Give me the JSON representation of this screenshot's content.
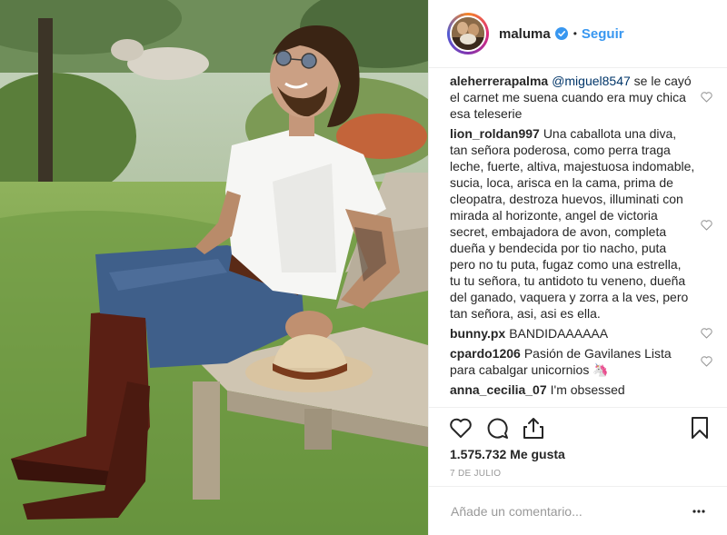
{
  "post": {
    "photo_alt": "post photo",
    "header": {
      "username": "maluma",
      "verified_icon": "verified-badge-icon",
      "separator": "•",
      "follow_label": "Seguir"
    },
    "comments": [
      {
        "user": "aleherrerapalma",
        "mention": "@miguel8547",
        "text": " se le cayó el carnet me suena cuando era muy chica esa teleserie"
      },
      {
        "user": "lion_roldan997",
        "mention": "",
        "text": "Una caballota una diva, tan señora poderosa, como perra traga leche, fuerte, altiva, majestuosa indomable, sucia, loca, arisca en la cama, prima de cleopatra, destroza huevos, illuminati con mirada al horizonte, angel de victoria secret, embajadora de avon, completa dueña y bendecida por tio nacho, puta pero no tu puta, fugaz como una estrella, tu tu señora, tu antidoto tu veneno, dueña del ganado, vaquera y zorra a la ves, pero tan señora, asi, asi es ella."
      },
      {
        "user": "bunny.px",
        "mention": "",
        "text": "BANDIDAAAAAA"
      },
      {
        "user": "cpardo1206",
        "mention": "",
        "text": "Pasión de Gavilanes Lista para cabalgar unicornios 🦄"
      },
      {
        "user": "anna_cecilia_07",
        "mention": "",
        "text": "I'm obsessed"
      }
    ],
    "actions": {
      "like_icon": "heart-outline-icon",
      "comment_icon": "comment-bubble-icon",
      "share_icon": "share-upload-icon",
      "save_icon": "bookmark-icon"
    },
    "likes_text": "1.575.732 Me gusta",
    "date_text": "7 DE JULIO",
    "comment_input": {
      "placeholder": "Añade un comentario...",
      "value": ""
    },
    "more_icon": "more-options-icon"
  },
  "colors": {
    "link_blue": "#3897f0",
    "text": "#262626",
    "muted": "#999999",
    "border": "#efefef",
    "mention": "#003569"
  }
}
